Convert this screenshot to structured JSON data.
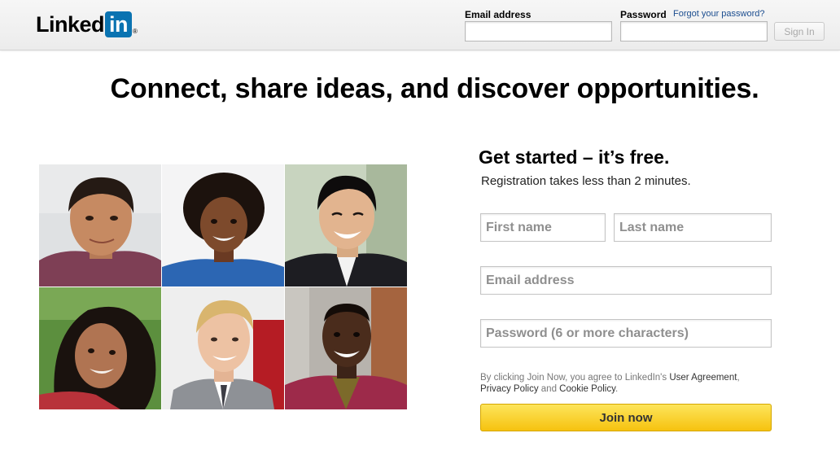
{
  "header": {
    "logo_text": "Linked",
    "logo_box_text": "in",
    "logo_reg": "®",
    "email_label": "Email address",
    "password_label": "Password",
    "forgot_link": "Forgot your password?",
    "email_value": "",
    "password_value": "",
    "signin_label": "Sign In"
  },
  "main": {
    "headline": "Connect, share ideas, and discover opportunities."
  },
  "signup": {
    "title": "Get started – it’s free.",
    "subtitle": "Registration takes less than 2 minutes.",
    "first_name_placeholder": "First name",
    "last_name_placeholder": "Last name",
    "email_placeholder": "Email address",
    "password_placeholder": "Password (6 or more characters)",
    "legal_prefix": "By clicking Join Now, you agree to LinkedIn's ",
    "user_agreement": "User Agreement",
    "legal_comma": ",",
    "privacy_policy": "Privacy Policy",
    "legal_and": " and ",
    "cookie_policy": "Cookie Policy",
    "legal_period": ".",
    "join_label": "Join now"
  },
  "colors": {
    "brand_blue": "#0a73b1",
    "link_blue": "#1b4d8f",
    "join_yellow": "#f6c20f"
  },
  "photos": [
    {
      "name": "member-photo-1"
    },
    {
      "name": "member-photo-2"
    },
    {
      "name": "member-photo-3"
    },
    {
      "name": "member-photo-4"
    },
    {
      "name": "member-photo-5"
    },
    {
      "name": "member-photo-6"
    }
  ]
}
